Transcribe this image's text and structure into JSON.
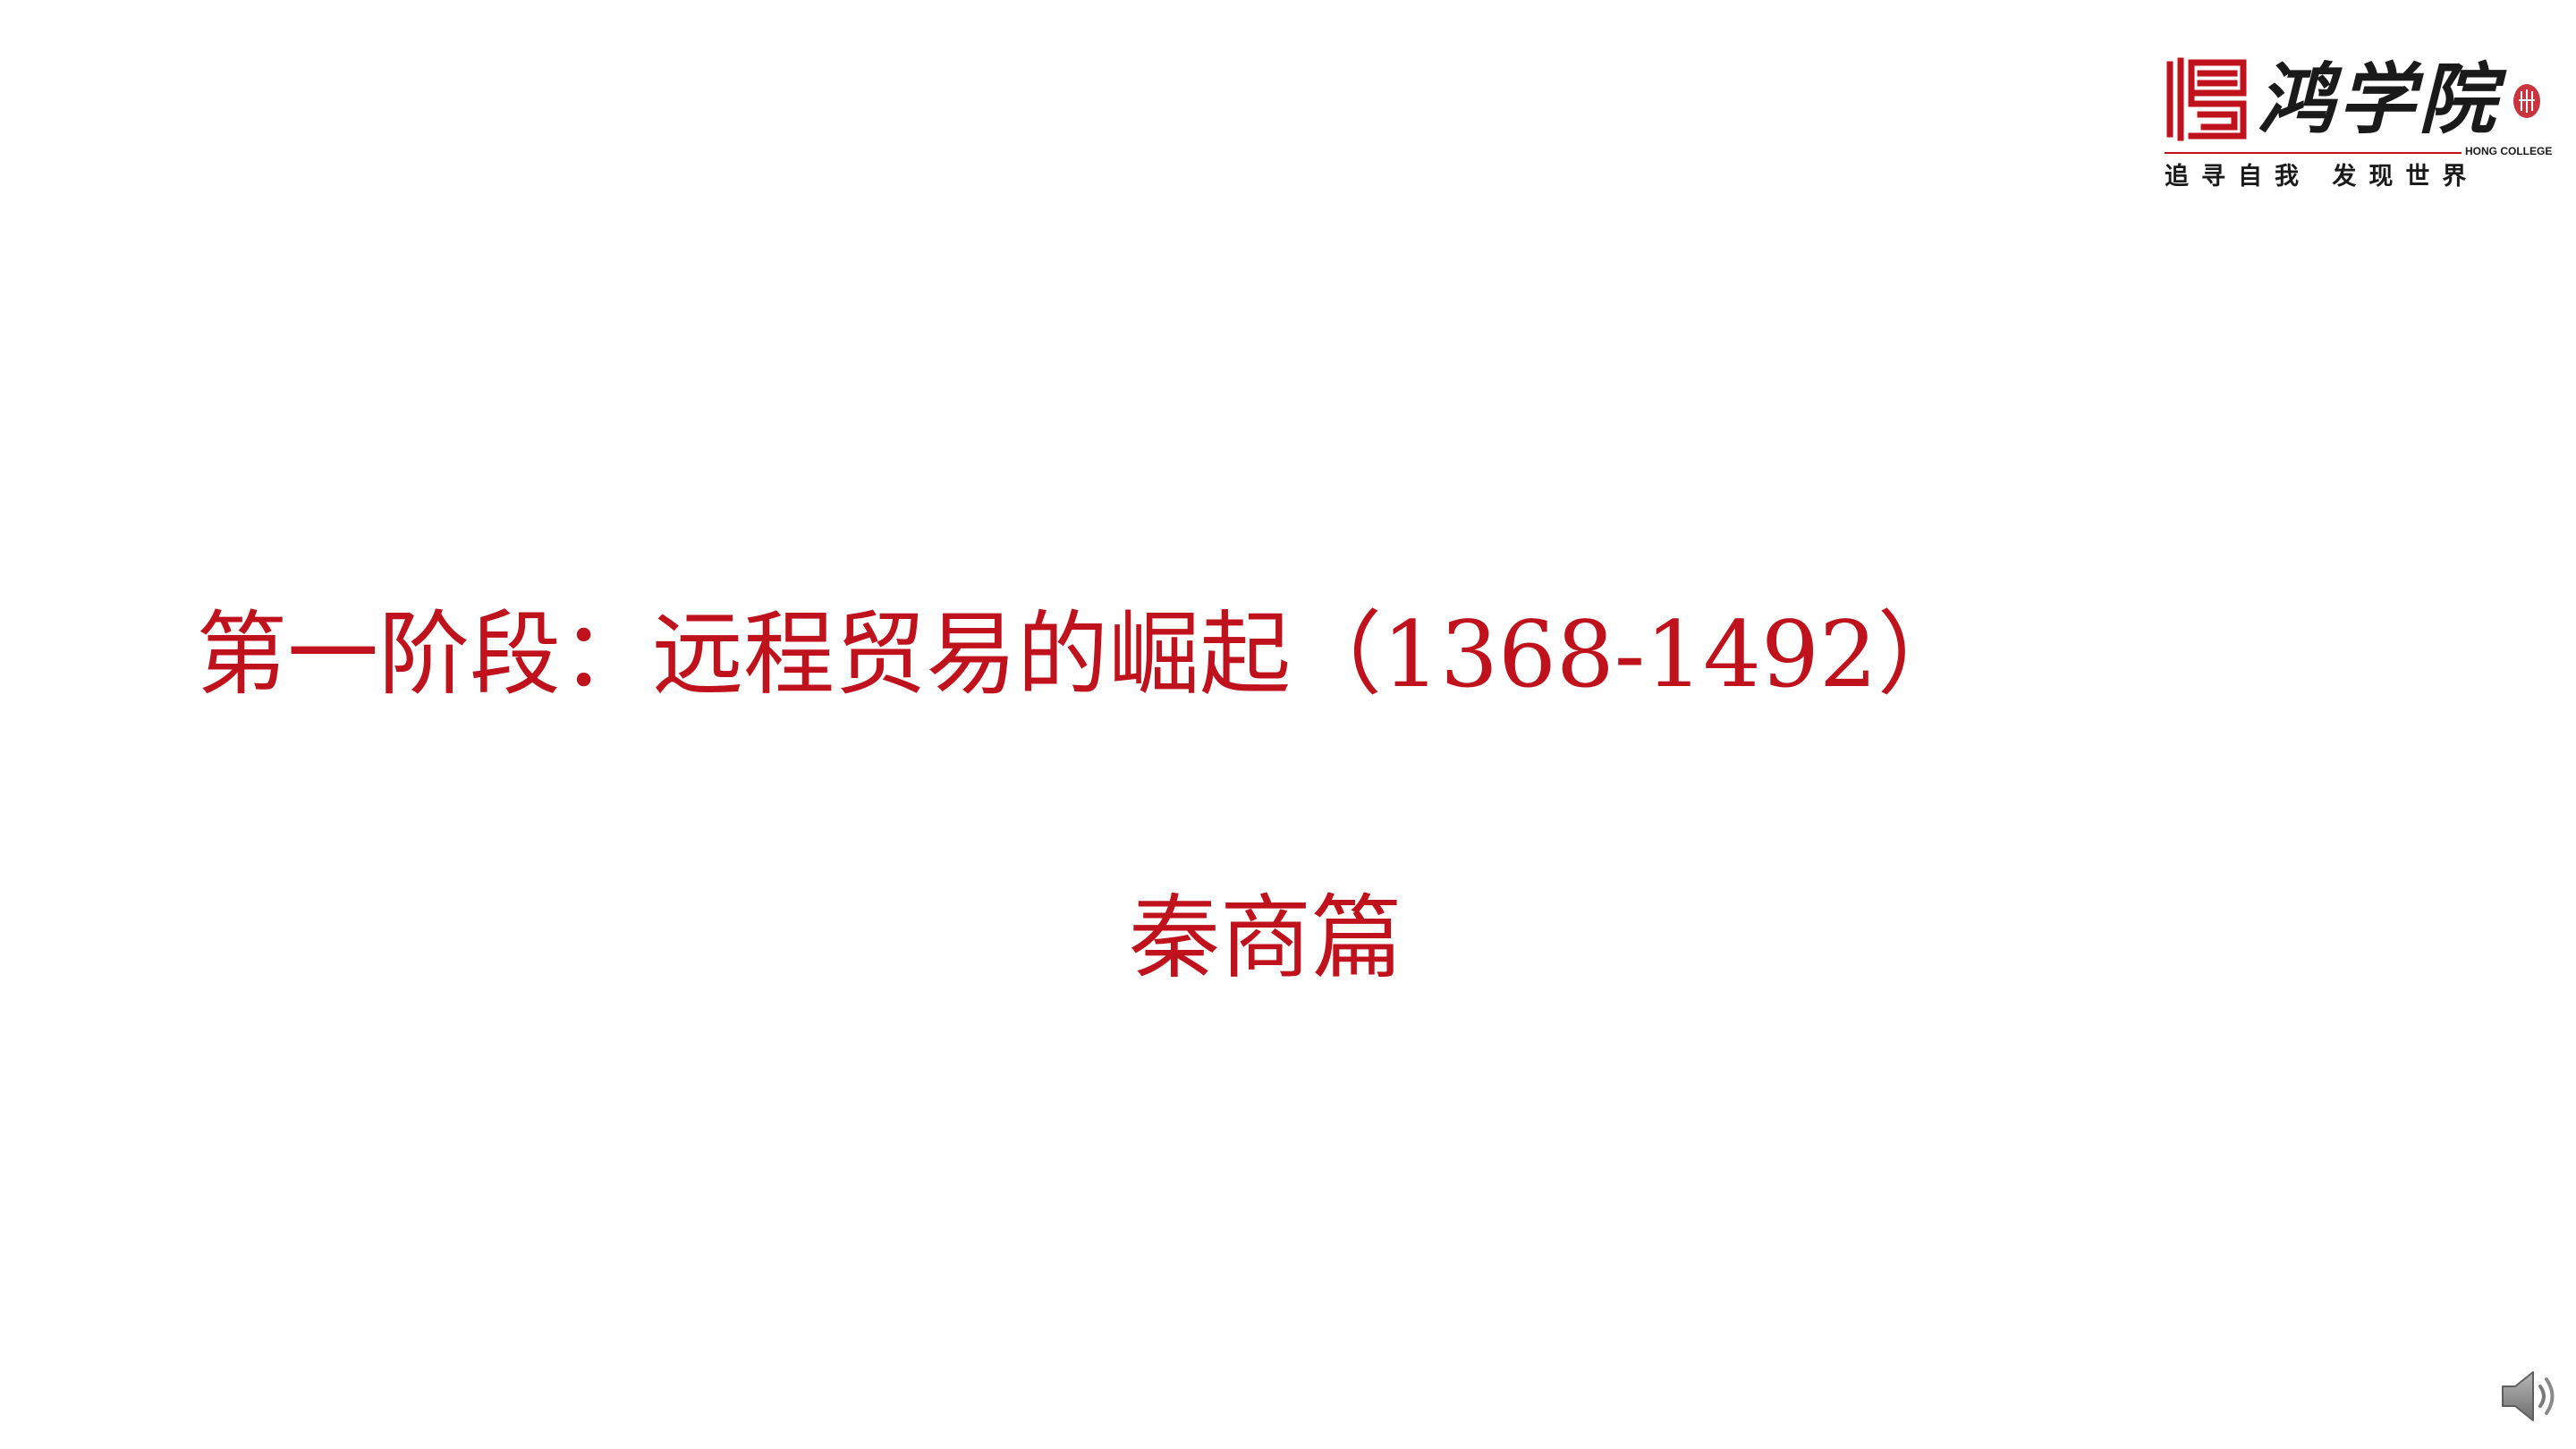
{
  "logo": {
    "wordmark": "鸿学院",
    "english": "HONG COLLEGE",
    "slogan": "追寻自我 发现世界",
    "mark_icon": "hong-college-emblem-icon",
    "seal_icon": "red-seal-icon"
  },
  "slide": {
    "title": "第一阶段：远程贸易的崛起（1368-1492）",
    "subtitle": "秦商篇"
  },
  "audio": {
    "icon": "speaker-icon"
  },
  "colors": {
    "accent_red": "#c0121c",
    "text_dark": "#1a1a1a",
    "background": "#ffffff",
    "speaker_gray": "#8a8a8a"
  }
}
